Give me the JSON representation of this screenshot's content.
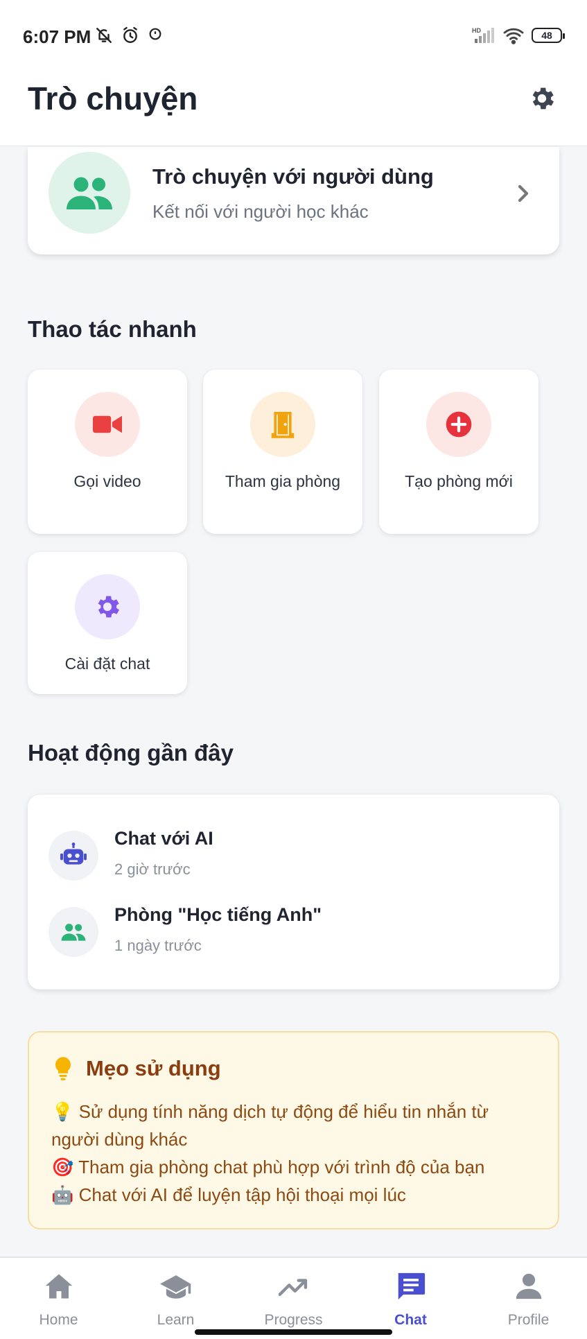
{
  "status_bar": {
    "time": "6:07 PM",
    "battery": "48",
    "icons": [
      "mute-bell-icon",
      "alarm-icon",
      "timer-icon",
      "signal-icon",
      "wifi-icon",
      "battery-icon"
    ]
  },
  "header": {
    "title": "Trò chuyện",
    "settings_icon": "gear-icon"
  },
  "user_chat": {
    "title": "Trò chuyện với người dùng",
    "subtitle": "Kết nối với người học khác",
    "icon": "people-icon",
    "icon_color": "#2bb37a",
    "icon_bg": "#dff3ea"
  },
  "quick_actions": {
    "title": "Thao tác nhanh",
    "items": [
      {
        "label": "Gọi video",
        "icon": "video-camera-icon",
        "color": "#e94040",
        "bg": "#fde7e5"
      },
      {
        "label": "Tham gia phòng",
        "icon": "door-icon",
        "color": "#f2a20c",
        "bg": "#fdefd9"
      },
      {
        "label": "Tạo phòng mới",
        "icon": "add-circle-icon",
        "color": "#e5323d",
        "bg": "#fde7e5"
      },
      {
        "label": "Cài đặt chat",
        "icon": "gear-icon",
        "color": "#8057e8",
        "bg": "#eee9fc"
      }
    ]
  },
  "recent": {
    "title": "Hoạt động gần đây",
    "items": [
      {
        "title": "Chat với AI",
        "time": "2 giờ trước",
        "icon": "robot-icon",
        "color": "#4a4fcf"
      },
      {
        "title": "Phòng \"Học tiếng Anh\"",
        "time": "1 ngày trước",
        "icon": "people-icon",
        "color": "#2bb37a"
      }
    ]
  },
  "tips": {
    "title": "Mẹo sử dụng",
    "icon": "lightbulb-icon",
    "lines": [
      "💡 Sử dụng tính năng dịch tự động để hiểu tin nhắn từ người dùng khác",
      "🎯 Tham gia phòng chat phù hợp với trình độ của bạn",
      "🤖 Chat với AI để luyện tập hội thoại mọi lúc"
    ]
  },
  "bottom_nav": {
    "items": [
      {
        "label": "Home",
        "icon": "home-icon",
        "active": false
      },
      {
        "label": "Learn",
        "icon": "graduation-cap-icon",
        "active": false
      },
      {
        "label": "Progress",
        "icon": "trending-up-icon",
        "active": false
      },
      {
        "label": "Chat",
        "icon": "chat-bubble-icon",
        "active": true
      },
      {
        "label": "Profile",
        "icon": "person-icon",
        "active": false
      }
    ],
    "active_color": "#4a4fcf"
  }
}
